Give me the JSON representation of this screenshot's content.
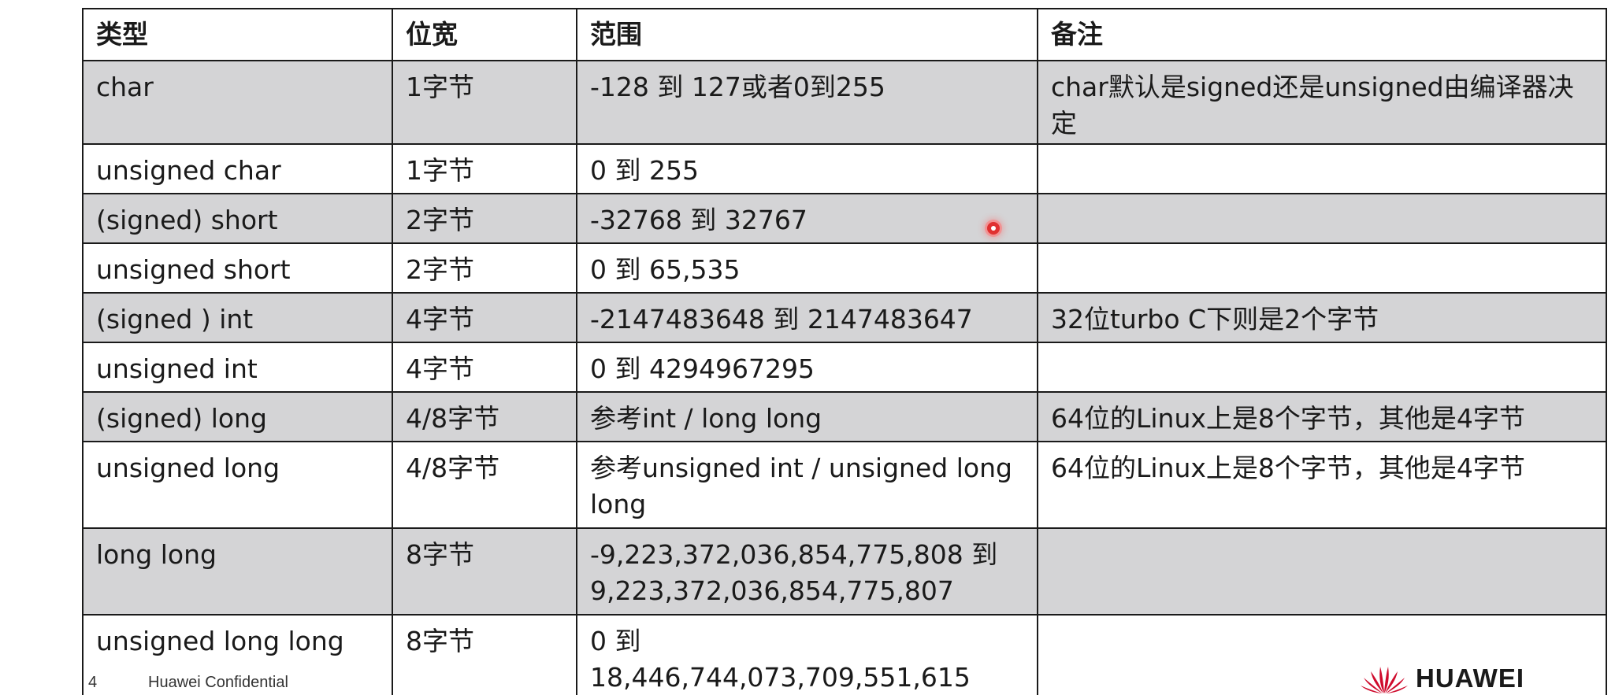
{
  "table": {
    "headers": [
      "类型",
      "位宽",
      "范围",
      "备注"
    ],
    "rows": [
      {
        "type": "char",
        "width": "1字节",
        "range": "-128 到 127或者0到255",
        "note": "char默认是signed还是unsigned由编译器决定"
      },
      {
        "type": "unsigned char",
        "width": "1字节",
        "range": "0 到 255",
        "note": ""
      },
      {
        "type": "(signed) short",
        "width": "2字节",
        "range": "-32768 到 32767",
        "note": ""
      },
      {
        "type": "unsigned short",
        "width": "2字节",
        "range": "0 到 65,535",
        "note": ""
      },
      {
        "type": "(signed ) int",
        "width": "4字节",
        "range": "-2147483648 到 2147483647",
        "note": "32位turbo C下则是2个字节"
      },
      {
        "type": "unsigned int",
        "width": "4字节",
        "range": "0 到 4294967295",
        "note": ""
      },
      {
        "type": "(signed) long",
        "width": "4/8字节",
        "range": "参考int / long long",
        "note": "64位的Linux上是8个字节，其他是4字节"
      },
      {
        "type": "unsigned long",
        "width": "4/8字节",
        "range": "参考unsigned int / unsigned long long",
        "note": "64位的Linux上是8个字节，其他是4字节"
      },
      {
        "type": "long long",
        "width": "8字节",
        "range": "-9,223,372,036,854,775,808 到 9,223,372,036,854,775,807",
        "note": ""
      },
      {
        "type": "unsigned long long",
        "width": "8字节",
        "range": "0 到 18,446,744,073,709,551,615",
        "note": ""
      }
    ]
  },
  "footer": {
    "page_number": "4",
    "confidential": "Huawei Confidential",
    "brand": "HUAWEI",
    "logo_icon": "huawei-petal-logo-icon"
  },
  "colors": {
    "row_gray": "#d4d4d6",
    "row_white": "#ffffff",
    "border": "#1a1a1a",
    "brand_red": "#cf0a2c",
    "pointer": "#e03030"
  }
}
